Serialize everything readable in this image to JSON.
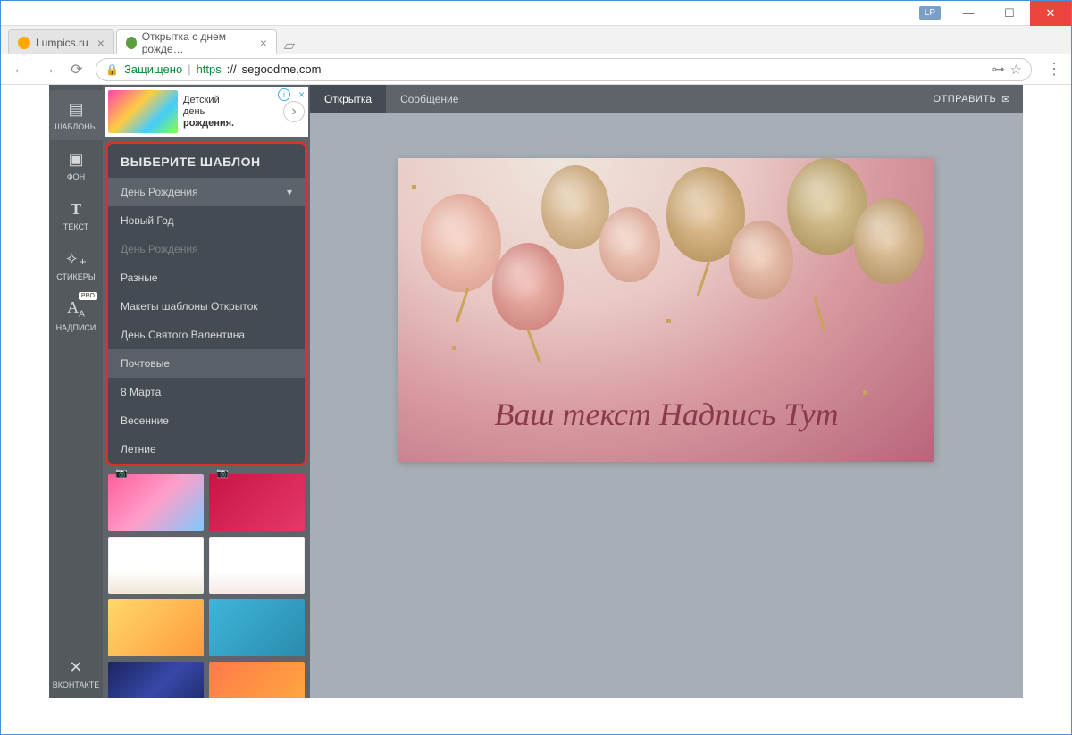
{
  "window": {
    "user_badge": "LP",
    "minimize": "—",
    "maximize": "☐",
    "close": "✕"
  },
  "tabs": {
    "tab1": "Lumpics.ru",
    "tab2": "Открытка с днем рожде…",
    "close": "×",
    "new": "+"
  },
  "address": {
    "back": "←",
    "forward": "→",
    "reload": "⟳",
    "secure_label": "Защищено",
    "protocol": "https",
    "sep": "://",
    "host": "segoodme.com",
    "key": "⊶",
    "star": "☆",
    "menu": "⋮"
  },
  "sidebar": {
    "templates": "ШАБЛОНЫ",
    "background": "ФОН",
    "text": "ТЕКСТ",
    "stickers": "СТИКЕРЫ",
    "labels": "НАДПИСИ",
    "pro": "PRO",
    "vk": "ВКОНТАКТЕ"
  },
  "ad": {
    "line1": "Детский",
    "line2": "день",
    "line3": "рождения.",
    "arrow": "›",
    "info": "i",
    "close": "×"
  },
  "template_panel": {
    "title": "ВЫБЕРИТЕ ШАБЛОН",
    "selected": "День Рождения",
    "caret": "▾",
    "options": {
      "o1": "Новый Год",
      "o2": "День Рождения",
      "o3": "Разные",
      "o4": "Макеты шаблоны Открыток",
      "o5": "День Святого Валентина",
      "o6": "Почтовые",
      "o7": "8 Марта",
      "o8": "Весенние",
      "o9": "Летние"
    }
  },
  "top_tabs": {
    "card": "Открытка",
    "message": "Сообщение",
    "send": "ОТПРАВИТЬ",
    "send_icon": "✉"
  },
  "card": {
    "text": "Ваш текст Надпись Тут"
  }
}
